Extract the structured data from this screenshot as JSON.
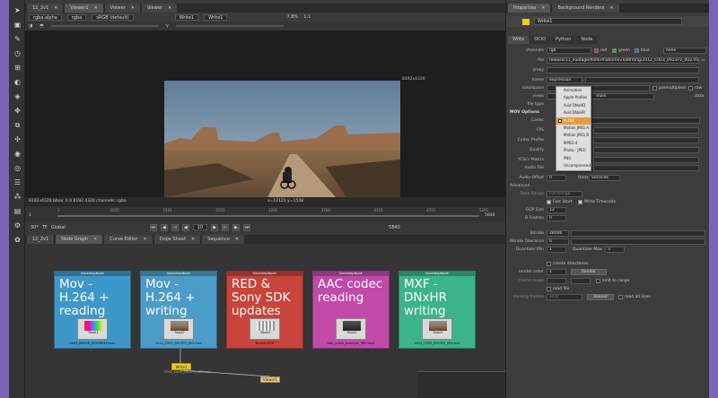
{
  "viewer": {
    "tabs": [
      {
        "label": "12_2v1"
      },
      {
        "label": "Viewer1"
      },
      {
        "label": "Viewer"
      },
      {
        "label": "Viewer"
      }
    ],
    "channels": "rgba",
    "channel_sel": "rgba.alpha",
    "colorspace": "sRGB (default)",
    "input_a": "Write1",
    "input_b": "Write1",
    "zoom": "7.8%",
    "zoom_ratio": "1:1",
    "format_top": "8192x4320",
    "format_bottom": "(8192x4320)",
    "status_left": "8192x4320  bbox: 0 0 8192 4320  channels: rgba",
    "status_coords": "x=12121 y=1548",
    "timeline_ticks": [
      "1",
      "1025",
      "1501",
      "2151",
      "3201",
      "3700",
      "4151",
      "4701",
      "5201"
    ],
    "timeline_start": "1",
    "timeline_end": "5840",
    "fps": "30*",
    "tf": "TF",
    "global": "Global",
    "frame_field": "10",
    "frame_end": "5840"
  },
  "node_tabs": [
    {
      "label": "12_2v1"
    },
    {
      "label": "Node Graph"
    },
    {
      "label": "Curve Editor"
    },
    {
      "label": "Dope Sheet"
    },
    {
      "label": "Sequence"
    }
  ],
  "backdrops": [
    {
      "header": "BackdropNode",
      "title": "Mov - H.264 + reading",
      "node": "Read1",
      "sub": "AVID_DNxHR_DCIHR444.mov"
    },
    {
      "header": "BackdropNode",
      "title": "Mov - H.264 + writing",
      "node": "Read2",
      "sub": "2012_C003_0923FV_002.mov"
    },
    {
      "header": "BackdropNode",
      "title": "RED & Sony SDK updates",
      "node": "Read3",
      "sub": "Kinesis.R3D"
    },
    {
      "header": "BackdropNode",
      "title": "AAC codec reading",
      "node": "Read4",
      "sub": "AAC_audio_example_360.mp4"
    },
    {
      "header": "BackdropNode",
      "title": "MXF - DNxHR writing",
      "node": "Read5",
      "sub": "2012_C003_0923FV_002.mxf"
    }
  ],
  "write_node": {
    "label": "Write1",
    "sub": "2012_C003_0923FV_002.mov"
  },
  "viewer_node": {
    "label": "Viewer1"
  },
  "props": {
    "tabs": [
      {
        "label": "Properties"
      },
      {
        "label": "Background Renders"
      }
    ],
    "node_name": "Write1",
    "subtabs": [
      {
        "label": "Write"
      },
      {
        "label": "OCIO"
      },
      {
        "label": "Python"
      },
      {
        "label": "Node"
      }
    ],
    "channels_label": "channels",
    "channels_value": "rgb",
    "chk_red": "red",
    "chk_green": "green",
    "chk_blue": "blue",
    "channels_extra": "none",
    "file_label": "file",
    "file_value": "release/11_Footage/fileformats/movToWriting/2012_C003_0923FV_002.mov",
    "proxy_label": "proxy",
    "frame_label": "frame",
    "frame_value": "expression",
    "colorspace_label": "colorspace",
    "premultiplied": "premultiplied",
    "raw_data": "raw data",
    "views_label": "views",
    "views_value": "main",
    "filetype_label": "file type",
    "mov_options": "MOV Options",
    "codec_label": "Codec",
    "fps_label": "FPS",
    "codec_profile_label": "Codec Profile",
    "quality_label": "Quality",
    "ycbcr_label": "YCbCr Matrix",
    "audio_file_label": "Audio File",
    "audio_offset_label": "Audio Offset",
    "audio_offset_value": "0",
    "units_label": "Units",
    "units_value": "Seconds",
    "advanced": "Advanced",
    "data_range_label": "Data Range",
    "data_range_value": "Full Range",
    "fast_start": "Fast Start",
    "write_timecode": "Write Timecode",
    "gop_label": "GOP Size",
    "gop_value": "12",
    "bframes_label": "B Frames",
    "bframes_value": "0",
    "bitrate_label": "Bitrate",
    "bitrate_value": "28000",
    "bitrate_tol_label": "Bitrate Tolerance",
    "bitrate_tol_value": "0",
    "qmin_label": "Quantizer Min",
    "qmin_value": "1",
    "qmax_label": "Quantizer Max",
    "qmax_value": "3",
    "create_dirs": "create directories",
    "render_order_label": "render order",
    "render_order_value": "1",
    "render_btn": "Render",
    "frame_range_label": "frame range",
    "limit_range": "limit to range",
    "read_file": "read file",
    "missing_label": "missing frames",
    "missing_value": "error",
    "reload_btn": "Reload",
    "read_all_lines": "read all lines"
  },
  "codec_menu": {
    "items": [
      {
        "label": "Animation"
      },
      {
        "label": "Apple ProRes"
      },
      {
        "label": "Avid DNxHD"
      },
      {
        "label": "Avid DNxHR"
      },
      {
        "label": "H.264"
      },
      {
        "label": "Motion JPEG A"
      },
      {
        "label": "Motion JPEG B"
      },
      {
        "label": "MPEG-4"
      },
      {
        "label": "Photo - JPEG"
      },
      {
        "label": "PNG"
      },
      {
        "label": "Uncompressed"
      }
    ],
    "selected_index": 4
  },
  "colors": {
    "backdrop_blue": "#3e97c9",
    "backdrop_blue2": "#4b9cc8",
    "backdrop_red": "#c9443b",
    "backdrop_magenta": "#c14aa9",
    "backdrop_green": "#3bb48a",
    "write_yellow": "#e8d21b",
    "menu_select": "#e89b3b"
  }
}
